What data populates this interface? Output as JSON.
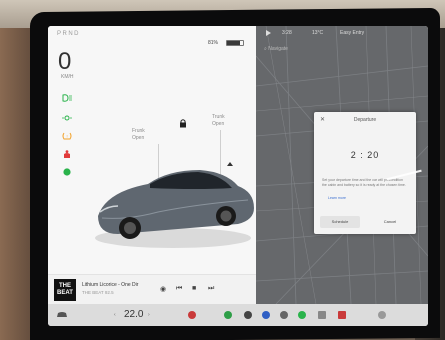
{
  "status": {
    "gear": "PRND",
    "speed": "0",
    "speed_unit": "KM/H",
    "battery": "81%"
  },
  "car": {
    "frunk_label": "Frunk",
    "frunk_action": "Open",
    "trunk_label": "Trunk",
    "trunk_action": "Open"
  },
  "media": {
    "album_text": "THE\nBEAT",
    "track": "Lithium Licorice - One Dir",
    "subtrack": "THE BEAT 92.5"
  },
  "map": {
    "top_time": "3:28",
    "top_temp": "13°C",
    "top_user": "Easy Entry",
    "search_placeholder": "Navigate"
  },
  "dialog": {
    "close": "✕",
    "title": "Departure",
    "time": "2 : 20",
    "text": "Set your departure time and the car will precondition the cabin and battery so it is ready at the chosen time.",
    "link": "Learn more",
    "primary": "Schedule",
    "secondary": "Cancel"
  },
  "bottom": {
    "temperature": "22.0"
  },
  "colors": {
    "indicator_green": "#2ab34b",
    "indicator_orange": "#f2a22a",
    "indicator_red": "#e13b3b",
    "map_bg": "#66686b"
  }
}
